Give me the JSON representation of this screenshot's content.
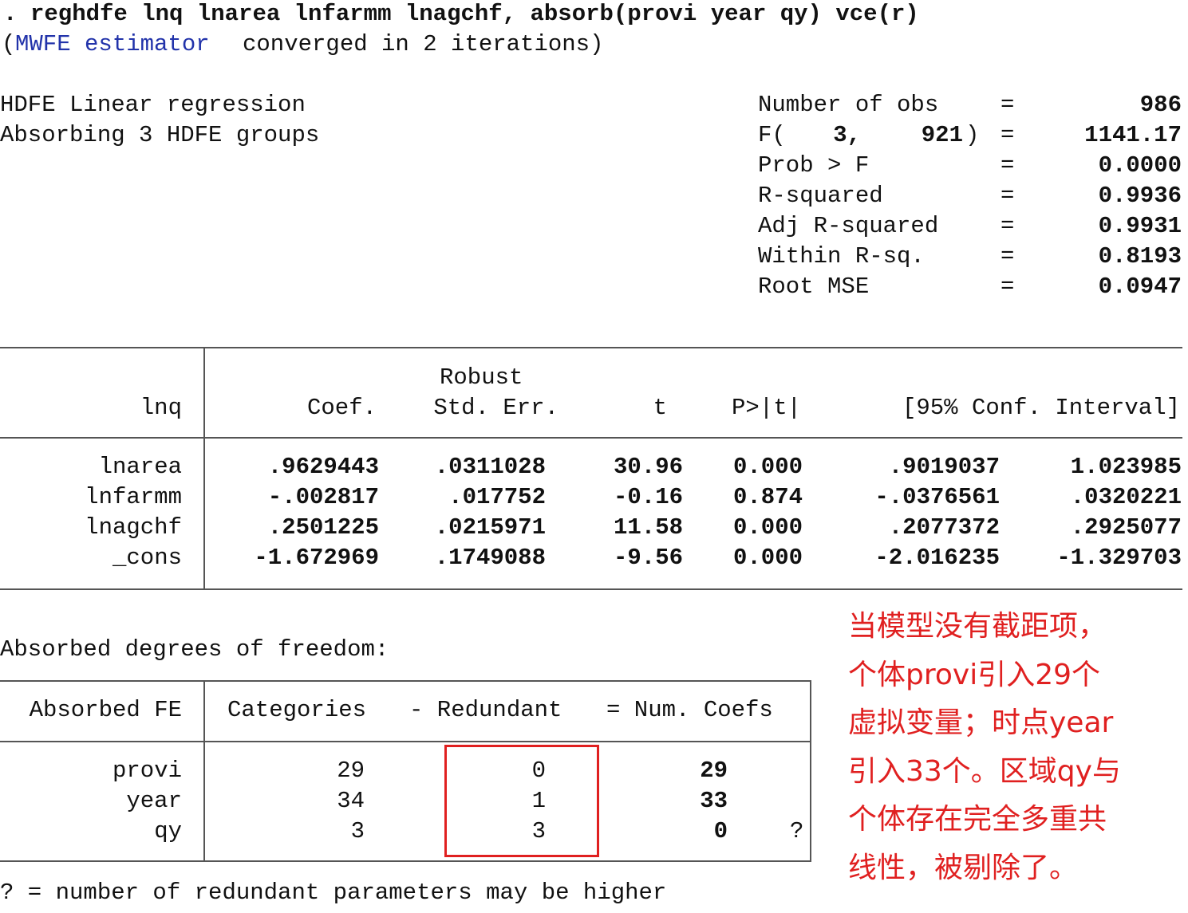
{
  "command": {
    "prompt": ".",
    "text": "reghdfe lnq lnarea lnfarmm lnagchf, absorb(provi year qy) vce(r)"
  },
  "convergence": {
    "open_paren": "(",
    "estimator": "MWFE estimator",
    "message": "converged in 2 iterations)"
  },
  "header": {
    "title": "HDFE Linear regression",
    "subtitle": "Absorbing 3 HDFE groups"
  },
  "stats": [
    {
      "label": "Number of obs",
      "eq": "=",
      "value": "986"
    },
    {
      "label": "F(",
      "df1": "3,",
      "df2": "921",
      "close": ")",
      "eq": "=",
      "value": "1141.17"
    },
    {
      "label": "Prob > F",
      "eq": "=",
      "value": "0.0000"
    },
    {
      "label": "R-squared",
      "eq": "=",
      "value": "0.9936"
    },
    {
      "label": "Adj R-squared",
      "eq": "=",
      "value": "0.9931"
    },
    {
      "label": "Within R-sq.",
      "eq": "=",
      "value": "0.8193"
    },
    {
      "label": "Root MSE",
      "eq": "=",
      "value": "0.0947"
    }
  ],
  "coef_table": {
    "depvar": "lnq",
    "headers": {
      "coef": "Coef.",
      "robust": "Robust",
      "se": "Std. Err.",
      "t": "t",
      "p": "P>|t|",
      "ci": "[95% Conf. Interval]"
    },
    "rows": [
      {
        "var": "lnarea",
        "coef": ".9629443",
        "se": ".0311028",
        "t": "30.96",
        "p": "0.000",
        "lo": ".9019037",
        "hi": "1.023985"
      },
      {
        "var": "lnfarmm",
        "coef": "-.002817",
        "se": ".017752",
        "t": "-0.16",
        "p": "0.874",
        "lo": "-.0376561",
        "hi": ".0320221"
      },
      {
        "var": "lnagchf",
        "coef": ".2501225",
        "se": ".0215971",
        "t": "11.58",
        "p": "0.000",
        "lo": ".2077372",
        "hi": ".2925077"
      },
      {
        "var": "_cons",
        "coef": "-1.672969",
        "se": ".1749088",
        "t": "-9.56",
        "p": "0.000",
        "lo": "-2.016235",
        "hi": "-1.329703"
      }
    ]
  },
  "absorbed": {
    "title": "Absorbed degrees of freedom:",
    "headers": {
      "fe": "Absorbed FE",
      "cat": "Categories",
      "red": "- Redundant",
      "num": "= Num. Coefs"
    },
    "rows": [
      {
        "fe": "provi",
        "cat": "29",
        "red": "0",
        "num": "29",
        "flag": ""
      },
      {
        "fe": "year",
        "cat": "34",
        "red": "1",
        "num": "33",
        "flag": ""
      },
      {
        "fe": "qy",
        "cat": "3",
        "red": "3",
        "num": "0",
        "flag": "?"
      }
    ],
    "footnote": "? = number of redundant parameters may be higher"
  },
  "annotation": {
    "color": "#e02020",
    "lines": [
      "当模型没有截距项，",
      "个体provi引入29个",
      "虚拟变量；时点year",
      "引入33个。区域qy与",
      "个体存在完全多重共",
      "线性，被剔除了。"
    ]
  }
}
